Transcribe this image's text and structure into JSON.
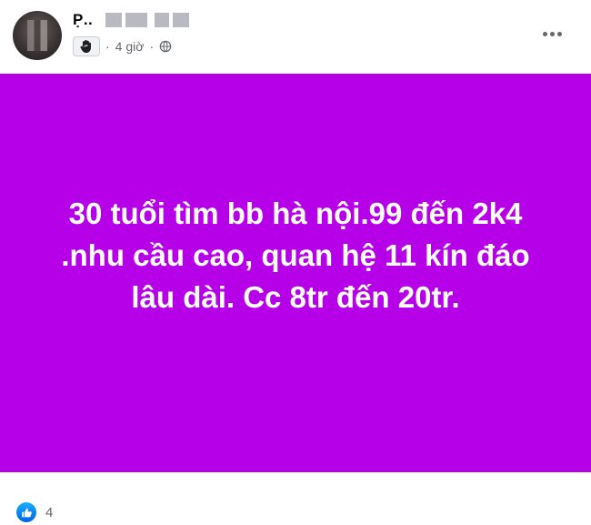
{
  "post": {
    "author_name": "P̣..",
    "time": "4 giờ",
    "dot": "·",
    "text": "30 tuổi tìm bb hà nội.99 đến 2k4 .nhu cầu cao, quan hệ 11 kín đáo lâu dài. Cc 8tr đến 20tr.",
    "background_color": "#b600e8",
    "reaction_count": "4"
  },
  "icons": {
    "badge": "wave-hand-icon",
    "privacy": "globe-icon",
    "menu": "more-horizontal-icon",
    "reaction": "like-icon"
  }
}
